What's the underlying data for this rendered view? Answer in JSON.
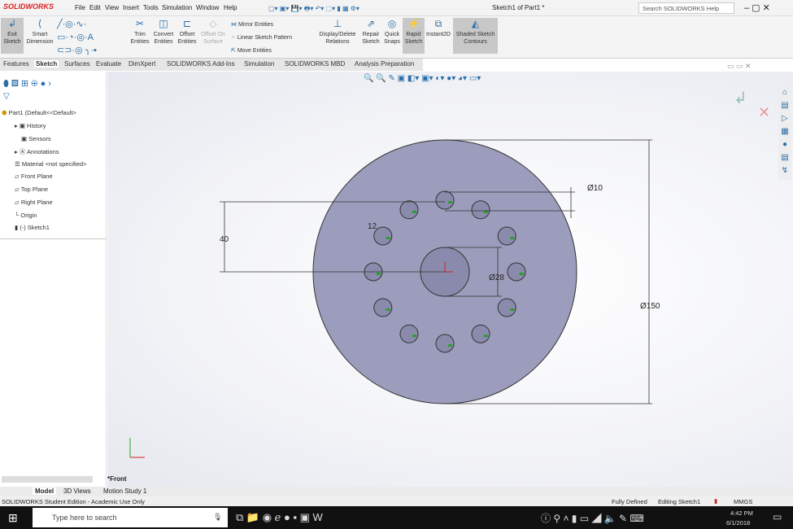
{
  "app": {
    "brand": "SOLIDWORKS",
    "title": "Sketch1 of Part1 *",
    "search_placeholder": "Search SOLIDWORKS Help"
  },
  "menu": [
    "File",
    "Edit",
    "View",
    "Insert",
    "Tools",
    "Simulation",
    "Window",
    "Help"
  ],
  "ribbon": {
    "exit_sketch": "Exit Sketch",
    "smart_dimension": "Smart Dimension",
    "trim": "Trim Entities",
    "convert": "Convert Entities",
    "offset": "Offset Entities",
    "offset_surface": "Offset On Surface",
    "mirror": "Mirror Entities",
    "linear_pattern": "Linear Sketch Pattern",
    "move": "Move Entities",
    "display_relations": "Display/Delete Relations",
    "repair": "Repair Sketch",
    "quick_snaps": "Quick Snaps",
    "rapid": "Rapid Sketch",
    "instant2d": "Instant2D",
    "shaded": "Shaded Sketch Contours"
  },
  "tabs": [
    "Features",
    "Sketch",
    "Surfaces",
    "Evaluate",
    "DimXpert",
    "SOLIDWORKS Add-Ins",
    "Simulation",
    "SOLIDWORKS MBD",
    "Analysis Preparation"
  ],
  "active_tab": "Sketch",
  "tree": {
    "root": "Part1  (Default<<Default>",
    "items": [
      "History",
      "Sensors",
      "Annotations",
      "Material <not specified>",
      "Front Plane",
      "Top Plane",
      "Right Plane",
      "Origin",
      "(-) Sketch1"
    ]
  },
  "sketch": {
    "dims": {
      "outer": "Ø150",
      "hole": "Ø10",
      "center": "Ø28",
      "offset": "40",
      "count": "12"
    },
    "hole_count": 12,
    "view_label": "*Front"
  },
  "bottom_tabs": [
    "Model",
    "3D Views",
    "Motion Study 1"
  ],
  "status": {
    "left": "SOLIDWORKS Student Edition - Academic Use Only",
    "state": "Fully Defined",
    "editing": "Editing Sketch1",
    "units": "MMGS"
  },
  "taskbar": {
    "search": "Type here to search",
    "time": "4:42 PM",
    "date": "6/1/2018"
  },
  "colors": {
    "disc": "#9c9cbc",
    "relation": "#2aa02a",
    "brand": "#d22222"
  }
}
